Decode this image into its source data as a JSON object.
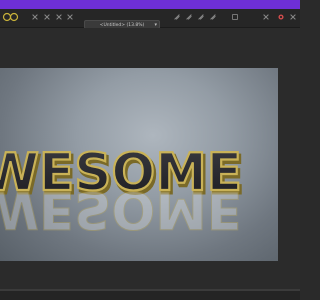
{
  "toolbar": {
    "document_title": "<Untitled> (13.8%)",
    "left_icons": [
      "grid-icon",
      "ellipse-icon",
      "snapping-icon",
      "brush-icon",
      "pen-icon",
      "node-icon",
      "transform-icon"
    ],
    "right_icons": [
      "align-icon",
      "distribute-icon",
      "flip-icon",
      "rotate-icon",
      "arrange-icon",
      "assistant-icon",
      "color-picker-icon"
    ]
  },
  "canvas": {
    "text": "WESOME",
    "text_color": "#2a2a2e",
    "outline_color": "#b8a24a",
    "background_center": "#aeb6be",
    "background_edge": "#586068"
  },
  "colors": {
    "accent": "#6e2fd6",
    "panel": "#2a2a2a",
    "toolbar": "#262626"
  }
}
